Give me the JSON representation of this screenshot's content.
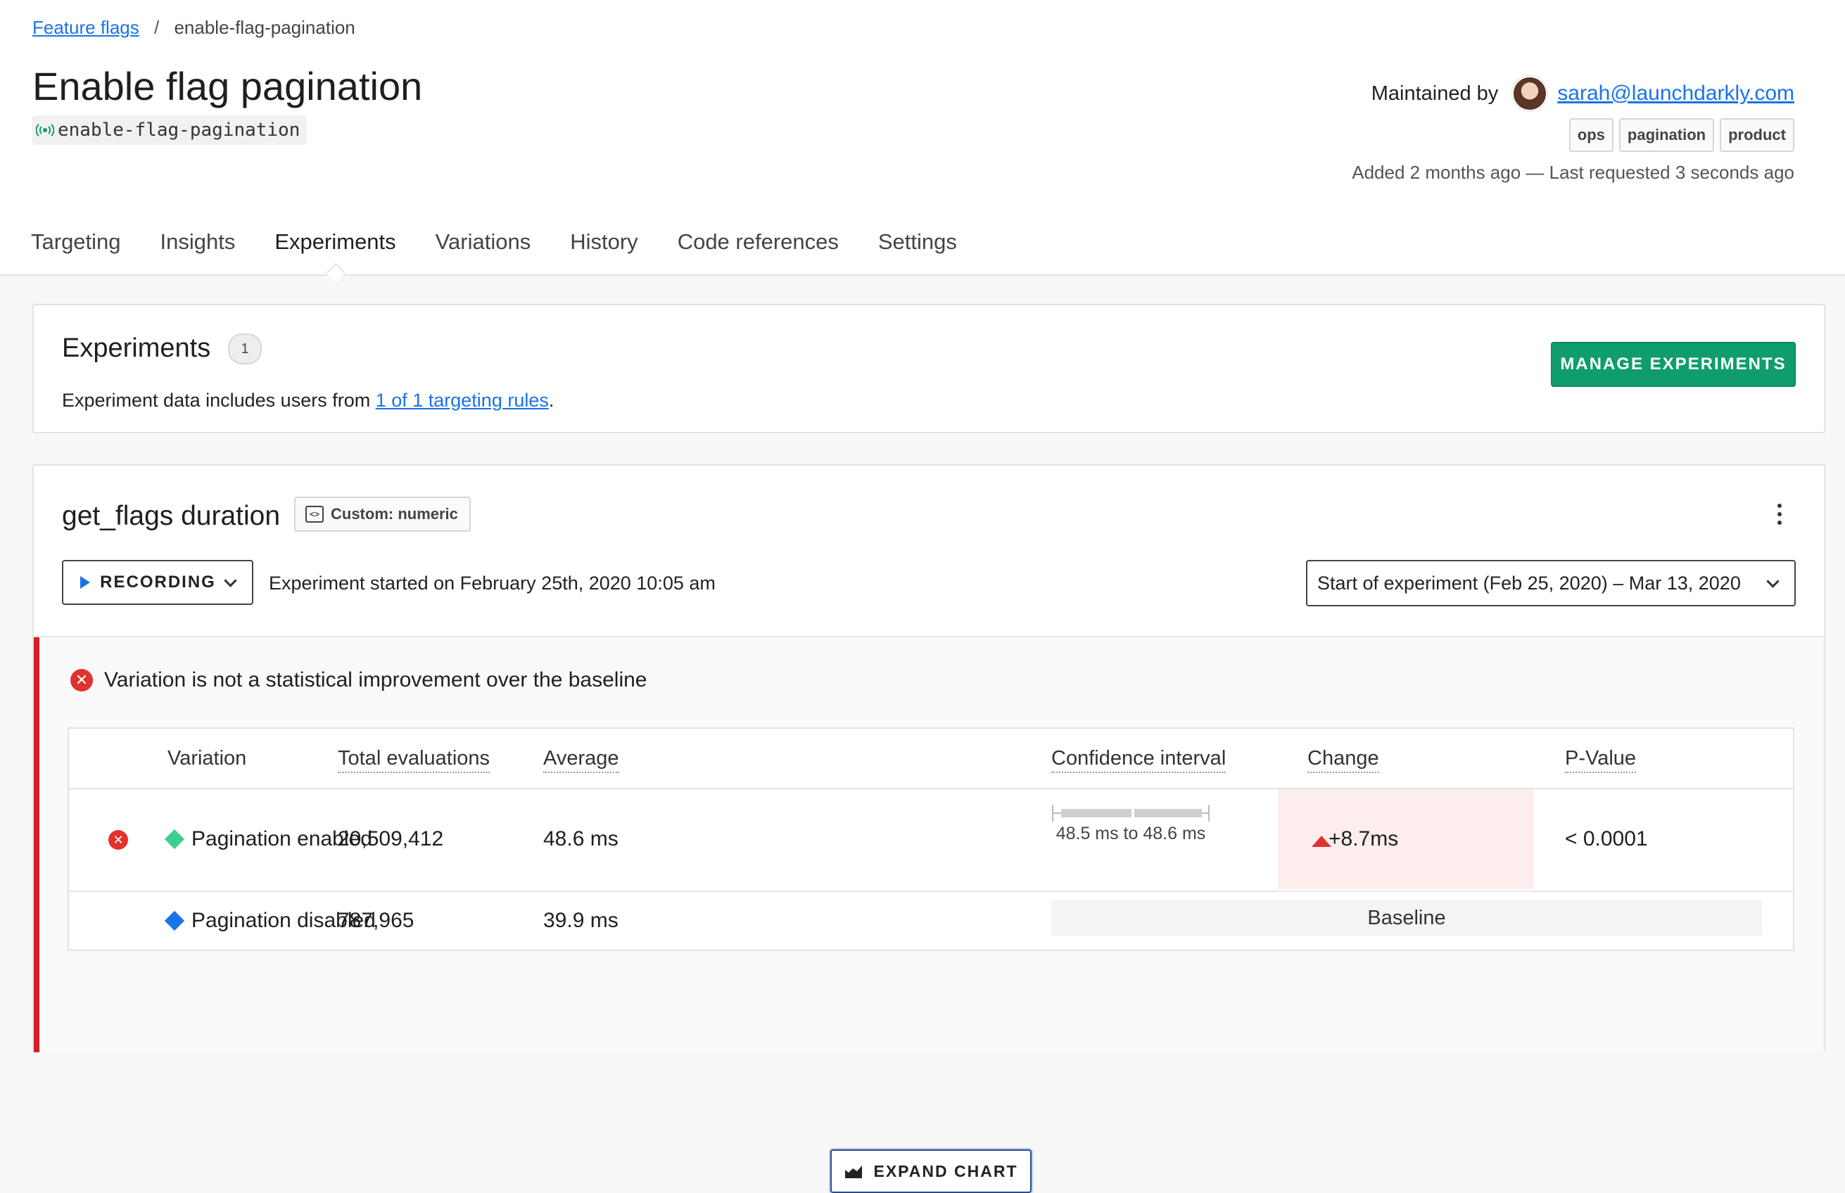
{
  "breadcrumb": {
    "parent": "Feature flags",
    "separator": "/",
    "current": "enable-flag-pagination"
  },
  "flag": {
    "title": "Enable flag pagination",
    "key": "enable-flag-pagination"
  },
  "maintainer": {
    "label": "Maintained by",
    "email": "sarah@launchdarkly.com"
  },
  "tags": [
    "ops",
    "pagination",
    "product"
  ],
  "meta": "Added 2 months ago — Last requested 3 seconds ago",
  "tabs": [
    {
      "label": "Targeting"
    },
    {
      "label": "Insights"
    },
    {
      "label": "Experiments"
    },
    {
      "label": "Variations"
    },
    {
      "label": "History"
    },
    {
      "label": "Code references"
    },
    {
      "label": "Settings"
    }
  ],
  "active_tab": "Experiments",
  "experiments": {
    "title": "Experiments",
    "count": "1",
    "desc_prefix": "Experiment data includes users from ",
    "desc_link": "1 of 1 targeting rules",
    "desc_suffix": ".",
    "manage_label": "MANAGE EXPERIMENTS"
  },
  "metric": {
    "name": "get_flags duration",
    "type_label": "Custom: numeric",
    "recording_label": "RECORDING",
    "started_text": "Experiment started on February 25th, 2020 10:05 am",
    "date_range": "Start of experiment (Feb 25, 2020) – Mar 13, 2020",
    "result_message": "Variation is not a statistical improvement over the baseline",
    "expand_label": "EXPAND CHART"
  },
  "table": {
    "headers": [
      "Variation",
      "Total evaluations",
      "Average",
      "Confidence interval",
      "Change",
      "P-Value"
    ],
    "rows": [
      {
        "variation": "Pagination enabled",
        "evaluations": "20,509,412",
        "average": "48.6 ms",
        "confidence_interval": "48.5 ms to 48.6 ms",
        "change": "+8.7ms",
        "p_value": "< 0.0001"
      },
      {
        "variation": "Pagination disabled",
        "evaluations": "787,965",
        "average": "39.9 ms",
        "baseline_label": "Baseline"
      }
    ]
  },
  "colors": {
    "accent_green": "#0f9d6e",
    "link_blue": "#1a73e8",
    "error_red": "#e2322e",
    "variation_enabled": "#3ecf8e",
    "variation_disabled": "#1a73e8"
  },
  "icons": {
    "flag_status": "live-signal-icon",
    "error": "x-circle-icon",
    "chart": "area-chart-icon"
  }
}
